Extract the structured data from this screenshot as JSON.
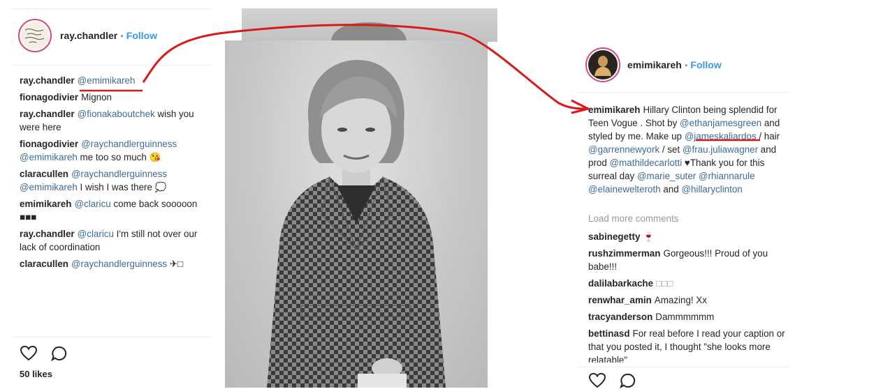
{
  "left_post": {
    "username": "ray.chandler",
    "separator": "•",
    "follow_label": "Follow",
    "comments": [
      {
        "user": "ray.chandler",
        "parts": [
          {
            "t": "@emimikareh",
            "m": true
          }
        ]
      },
      {
        "user": "fionagodivier",
        "parts": [
          {
            "t": "Mignon",
            "m": false
          }
        ]
      },
      {
        "user": "ray.chandler",
        "parts": [
          {
            "t": "@fionakaboutchek",
            "m": true
          },
          {
            "t": " wish you were here",
            "m": false
          }
        ]
      },
      {
        "user": "fionagodivier",
        "parts": [
          {
            "t": "@raychandlerguinness @emimikareh",
            "m": true
          },
          {
            "t": " me too so much 😘",
            "m": false
          }
        ]
      },
      {
        "user": "claracullen",
        "parts": [
          {
            "t": "@raychandlerguinness @emimikareh",
            "m": true
          },
          {
            "t": " I wish I was there 💭",
            "m": false
          }
        ]
      },
      {
        "user": "emimikareh",
        "parts": [
          {
            "t": "@claricu",
            "m": true
          },
          {
            "t": " come back sooooon ■■■",
            "m": false
          }
        ]
      },
      {
        "user": "ray.chandler",
        "parts": [
          {
            "t": "@claricu",
            "m": true
          },
          {
            "t": " I'm still not over our lack of coordination",
            "m": false
          }
        ]
      },
      {
        "user": "claracullen",
        "parts": [
          {
            "t": "@raychandlerguinness",
            "m": true
          },
          {
            "t": " ✈□",
            "m": false
          }
        ]
      }
    ],
    "likes": "50 likes"
  },
  "right_post": {
    "username": "emimikareh",
    "separator": "•",
    "follow_label": "Follow",
    "caption": {
      "user": "emimikareh",
      "parts": [
        {
          "t": "Hillary Clinton being splendid for Teen Vogue . Shot by ",
          "m": false
        },
        {
          "t": "@ethanjamesgreen",
          "m": true
        },
        {
          "t": " and styled by me. Make up ",
          "m": false
        },
        {
          "t": "@jameskaliardos",
          "m": true
        },
        {
          "t": " / hair ",
          "m": false
        },
        {
          "t": "@garrennewyork",
          "m": true
        },
        {
          "t": " / set ",
          "m": false
        },
        {
          "t": "@frau.juliawagner",
          "m": true
        },
        {
          "t": " and prod ",
          "m": false
        },
        {
          "t": "@mathildecarlotti",
          "m": true
        },
        {
          "t": " ♥Thank you for this surreal day ",
          "m": false
        },
        {
          "t": "@marie_suter @rhiannarule @elainewelteroth",
          "m": true
        },
        {
          "t": " and ",
          "m": false
        },
        {
          "t": "@hillaryclinton",
          "m": true
        }
      ]
    },
    "load_more": "Load more comments",
    "comments": [
      {
        "user": "sabinegetty",
        "parts": [
          {
            "t": "🍷",
            "m": false
          }
        ]
      },
      {
        "user": "rushzimmerman",
        "parts": [
          {
            "t": "Gorgeous!!! Proud of you babe!!!",
            "m": false
          }
        ]
      },
      {
        "user": "dalilabarkache",
        "parts": [
          {
            "t": "□□□",
            "m": false,
            "muted": true
          }
        ]
      },
      {
        "user": "renwhar_amin",
        "parts": [
          {
            "t": "Amazing! Xx",
            "m": false
          }
        ]
      },
      {
        "user": "tracyanderson",
        "parts": [
          {
            "t": "Dammmmmm",
            "m": false
          }
        ]
      },
      {
        "user": "bettinasd",
        "parts": [
          {
            "t": "For real before I read your caption or that you posted it, I thought \"she looks more relatable\"",
            "m": false
          }
        ]
      }
    ]
  },
  "colors": {
    "follow": "#3897f0",
    "mention": "#3d6b9a",
    "annotation": "#d91a1a",
    "avatar_ring": "#d64a7c"
  }
}
